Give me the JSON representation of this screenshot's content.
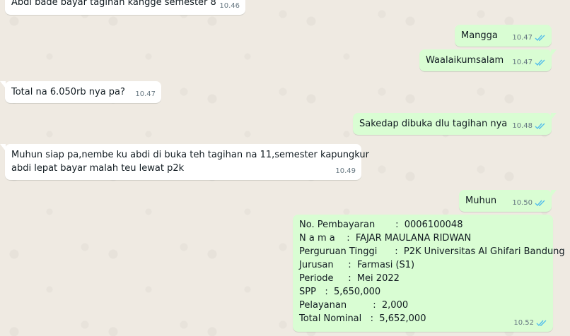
{
  "colors": {
    "incoming_bubble": "#ffffff",
    "outgoing_bubble": "#d9fdd3",
    "read_ticks": "#53bdeb",
    "timestamp": "#667781"
  },
  "messages": [
    {
      "direction": "in",
      "text": "Abdi bade bayar tagihan kangge semester 8",
      "time": "10.46"
    },
    {
      "direction": "out",
      "text": "Mangga",
      "time": "10.47",
      "status": "read"
    },
    {
      "direction": "out",
      "text": "Waalaikumsalam",
      "time": "10.47",
      "status": "read"
    },
    {
      "direction": "in",
      "text": "Total na 6.050rb nya pa?",
      "time": "10.47"
    },
    {
      "direction": "out",
      "text": "Sakedap dibuka dlu tagihan nya",
      "time": "10.48",
      "status": "read"
    },
    {
      "direction": "in",
      "line1": "Muhun siap pa,nembe ku abdi di buka teh tagihan na 11,semester kapungkur",
      "line2": "abdi lepat bayar malah teu lewat p2k",
      "time": "10.49"
    },
    {
      "direction": "out",
      "text": "Muhun",
      "time": "10.50",
      "status": "read"
    },
    {
      "direction": "out",
      "time": "10.52",
      "status": "read",
      "lines": [
        "No. Pembayaran       :  0006100048",
        "N a m a    :  FAJAR MAULANA RIDWAN",
        "Perguruan Tinggi      :  P2K Universitas Al Ghifari Bandung",
        "Jurusan     :  Farmasi (S1)",
        "Periode     :  Mei 2022",
        "SPP   :  5,650,000",
        "Pelayanan         :  2,000",
        "Total Nominal   :  5,652,000"
      ]
    }
  ]
}
